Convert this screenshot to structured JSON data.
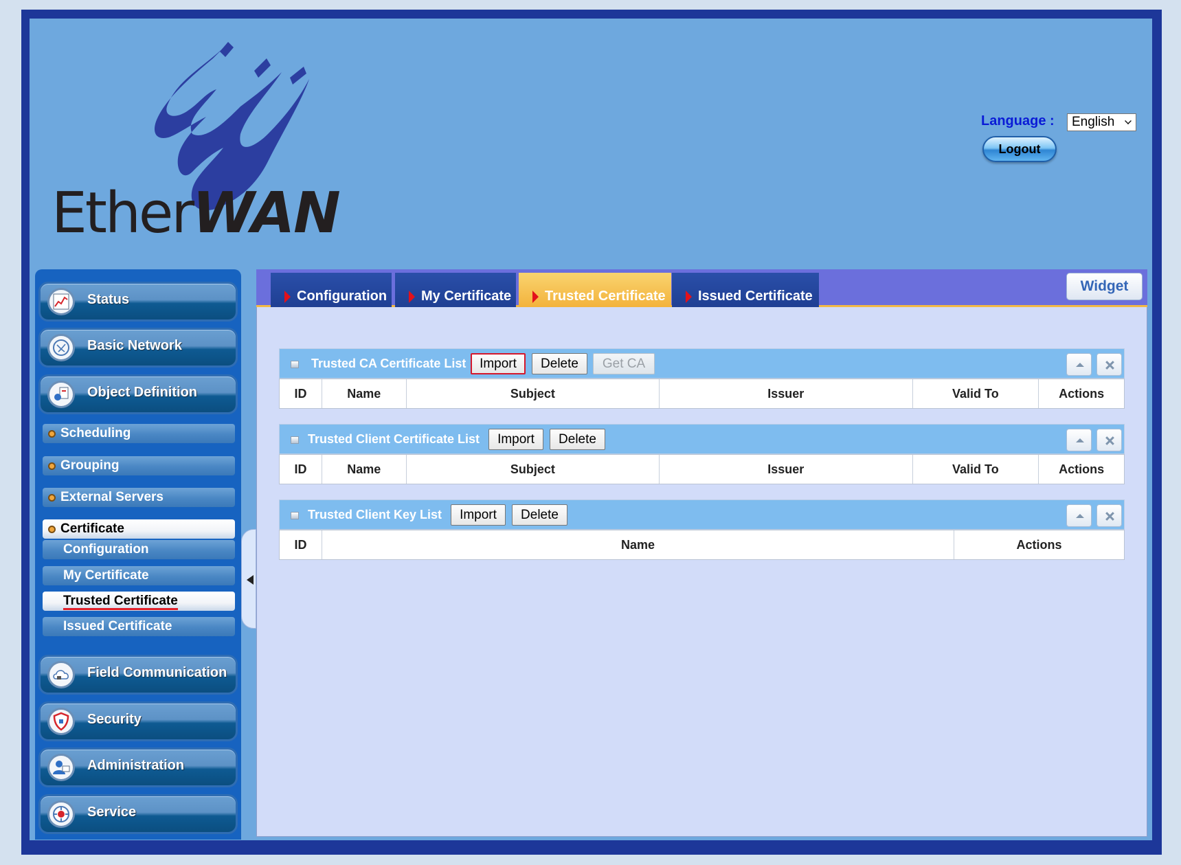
{
  "brand": {
    "name_thin": "Ether",
    "name_bold": "WAN"
  },
  "header": {
    "language_label": "Language :",
    "language_value": "English",
    "logout_label": "Logout"
  },
  "sidebar": {
    "main_top": [
      {
        "label": "Status",
        "icon": "chart-icon"
      },
      {
        "label": "Basic Network",
        "icon": "network-icon"
      },
      {
        "label": "Object Definition",
        "icon": "object-icon"
      }
    ],
    "sub_items": [
      {
        "label": "Scheduling"
      },
      {
        "label": "Grouping"
      },
      {
        "label": "External Servers"
      },
      {
        "label": "Certificate"
      }
    ],
    "certificate_items": [
      {
        "label": "Configuration"
      },
      {
        "label": "My Certificate"
      },
      {
        "label": "Trusted Certificate"
      },
      {
        "label": "Issued Certificate"
      }
    ],
    "main_bottom": [
      {
        "label": "Field Communication",
        "icon": "cloud-icon"
      },
      {
        "label": "Security",
        "icon": "shield-icon"
      },
      {
        "label": "Administration",
        "icon": "admin-icon"
      },
      {
        "label": "Service",
        "icon": "service-icon"
      }
    ]
  },
  "tabs": [
    {
      "label": "Configuration"
    },
    {
      "label": "My Certificate"
    },
    {
      "label": "Trusted Certificate"
    },
    {
      "label": "Issued Certificate"
    }
  ],
  "widget_label": "Widget",
  "panels": [
    {
      "title": "Trusted CA Certificate List",
      "buttons": [
        "Import",
        "Delete",
        "Get CA"
      ],
      "columns": [
        "ID",
        "Name",
        "Subject",
        "Issuer",
        "Valid To",
        "Actions"
      ]
    },
    {
      "title": "Trusted Client Certificate List",
      "buttons": [
        "Import",
        "Delete"
      ],
      "columns": [
        "ID",
        "Name",
        "Subject",
        "Issuer",
        "Valid To",
        "Actions"
      ]
    },
    {
      "title": "Trusted Client Key List",
      "buttons": [
        "Import",
        "Delete"
      ],
      "columns": [
        "ID",
        "Name",
        "Actions"
      ]
    }
  ],
  "colors": {
    "frame": "#1d3799",
    "header_bg": "#6ea8de",
    "sidebar_bg": "#1763c0",
    "tab_active": "#f3b33c",
    "panel_head": "#7ebcef",
    "content_bg": "#d2dcf9"
  }
}
